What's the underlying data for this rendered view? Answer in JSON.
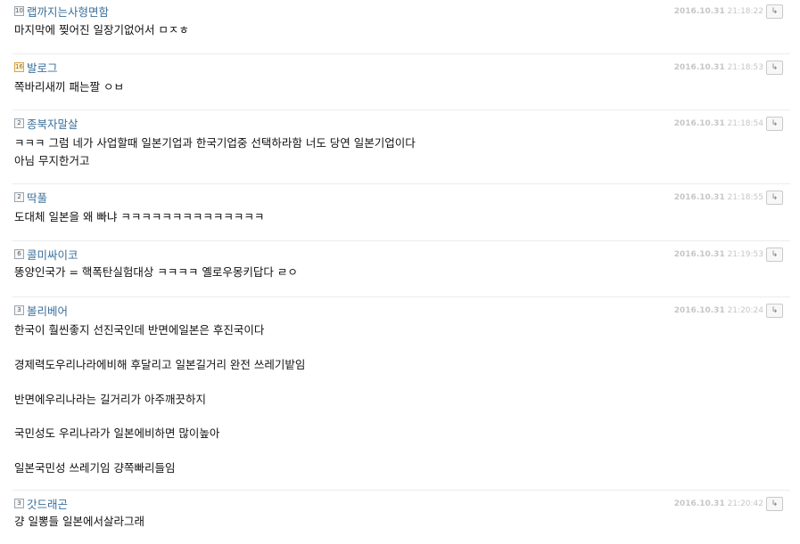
{
  "comments": [
    {
      "level": "10",
      "level_style": "plain",
      "nick": "랩까지는사형면함",
      "date": "2016.10.31",
      "time": "21:18:22",
      "lines": [
        "마지막에 찢어진 일장기없어서 ㅁㅈㅎ"
      ]
    },
    {
      "level": "16",
      "level_style": "gold",
      "nick": "발로그",
      "date": "2016.10.31",
      "time": "21:18:53",
      "lines": [
        "쪽바리새끼 패는짤 ㅇㅂ"
      ]
    },
    {
      "level": "2",
      "level_style": "plain",
      "nick": "종북자말살",
      "date": "2016.10.31",
      "time": "21:18:54",
      "lines": [
        "ㅋㅋㅋ 그럼 네가 사업할때 일본기업과 한국기업중 선택하라함 너도 당연 일본기업이다",
        "아님 무지한거고"
      ]
    },
    {
      "level": "2",
      "level_style": "plain",
      "nick": "딱풀",
      "date": "2016.10.31",
      "time": "21:18:55",
      "lines": [
        "도대체 일본을 왜 빠냐 ㅋㅋㅋㅋㅋㅋㅋㅋㅋㅋㅋㅋㅋㅋ"
      ]
    },
    {
      "level": "6",
      "level_style": "plain",
      "nick": "콜미싸이코",
      "date": "2016.10.31",
      "time": "21:19:53",
      "lines": [
        "똥양인국가 = 핵폭탄실험대상 ㅋㅋㅋㅋ 옐로우몽키답다 ㄹㅇ"
      ]
    },
    {
      "level": "3",
      "level_style": "plain",
      "nick": "볼리베어",
      "date": "2016.10.31",
      "time": "21:20:24",
      "lines": [
        "한국이 훨씬좋지 선진국인데 반면에일본은 후진국이다",
        "",
        "경제력도우리나라에비해 후달리고 일본길거리 완전 쓰레기밭임",
        "",
        "반면에우리나라는 길거리가 아주깨끗하지",
        "",
        "국민성도 우리나라가 일본에비하면 많이높아",
        "",
        "일본국민성 쓰레기임 걍쪽빠리들임"
      ]
    },
    {
      "level": "3",
      "level_style": "plain",
      "nick": "갓드래곤",
      "date": "2016.10.31",
      "time": "21:20:42",
      "lines": [
        "걍 일뽕들 일본에서살라그래"
      ]
    }
  ],
  "reply_icon": "reply-arrow-icon"
}
